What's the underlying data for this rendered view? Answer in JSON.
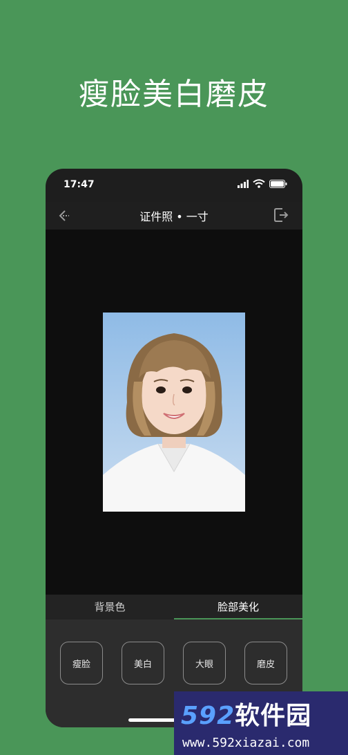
{
  "headline": "瘦脸美白磨皮",
  "status_bar": {
    "time": "17:47",
    "icons": [
      "signal-icon",
      "wifi-icon",
      "battery-icon"
    ]
  },
  "nav": {
    "title": "证件照 • 一寸",
    "back_icon": "back-arrow-icon",
    "export_icon": "export-icon"
  },
  "tabs": [
    {
      "label": "背景色",
      "active": false
    },
    {
      "label": "脸部美化",
      "active": true
    }
  ],
  "tools": [
    "瘦脸",
    "美白",
    "大眼",
    "磨皮"
  ],
  "watermark": {
    "brand_number": "592",
    "brand_text": "软件园",
    "url": "www.592xiazai.com"
  },
  "colors": {
    "background": "#4a9658",
    "phone_body": "#1e1e1e",
    "accent": "#4a9658"
  }
}
